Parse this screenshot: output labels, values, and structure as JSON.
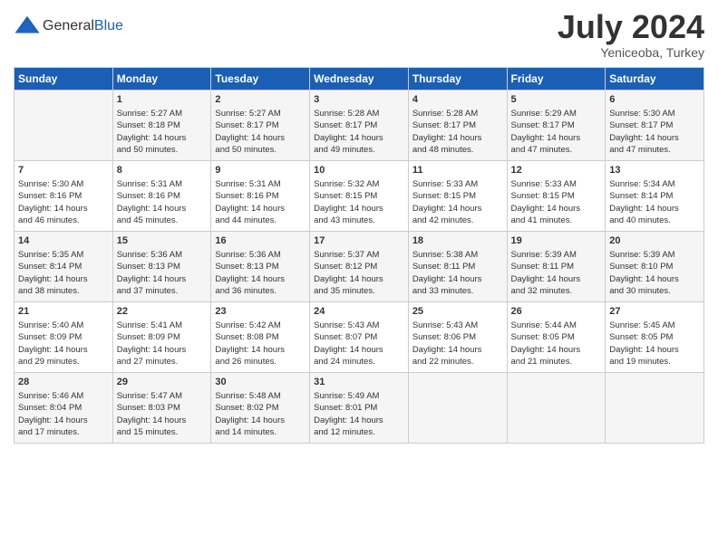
{
  "header": {
    "logo": {
      "general": "General",
      "blue": "Blue"
    },
    "title": "July 2024",
    "subtitle": "Yeniceoba, Turkey"
  },
  "weekdays": [
    "Sunday",
    "Monday",
    "Tuesday",
    "Wednesday",
    "Thursday",
    "Friday",
    "Saturday"
  ],
  "weeks": [
    [
      {
        "day": "",
        "info": ""
      },
      {
        "day": "1",
        "info": "Sunrise: 5:27 AM\nSunset: 8:18 PM\nDaylight: 14 hours\nand 50 minutes."
      },
      {
        "day": "2",
        "info": "Sunrise: 5:27 AM\nSunset: 8:17 PM\nDaylight: 14 hours\nand 50 minutes."
      },
      {
        "day": "3",
        "info": "Sunrise: 5:28 AM\nSunset: 8:17 PM\nDaylight: 14 hours\nand 49 minutes."
      },
      {
        "day": "4",
        "info": "Sunrise: 5:28 AM\nSunset: 8:17 PM\nDaylight: 14 hours\nand 48 minutes."
      },
      {
        "day": "5",
        "info": "Sunrise: 5:29 AM\nSunset: 8:17 PM\nDaylight: 14 hours\nand 47 minutes."
      },
      {
        "day": "6",
        "info": "Sunrise: 5:30 AM\nSunset: 8:17 PM\nDaylight: 14 hours\nand 47 minutes."
      }
    ],
    [
      {
        "day": "7",
        "info": "Sunrise: 5:30 AM\nSunset: 8:16 PM\nDaylight: 14 hours\nand 46 minutes."
      },
      {
        "day": "8",
        "info": "Sunrise: 5:31 AM\nSunset: 8:16 PM\nDaylight: 14 hours\nand 45 minutes."
      },
      {
        "day": "9",
        "info": "Sunrise: 5:31 AM\nSunset: 8:16 PM\nDaylight: 14 hours\nand 44 minutes."
      },
      {
        "day": "10",
        "info": "Sunrise: 5:32 AM\nSunset: 8:15 PM\nDaylight: 14 hours\nand 43 minutes."
      },
      {
        "day": "11",
        "info": "Sunrise: 5:33 AM\nSunset: 8:15 PM\nDaylight: 14 hours\nand 42 minutes."
      },
      {
        "day": "12",
        "info": "Sunrise: 5:33 AM\nSunset: 8:15 PM\nDaylight: 14 hours\nand 41 minutes."
      },
      {
        "day": "13",
        "info": "Sunrise: 5:34 AM\nSunset: 8:14 PM\nDaylight: 14 hours\nand 40 minutes."
      }
    ],
    [
      {
        "day": "14",
        "info": "Sunrise: 5:35 AM\nSunset: 8:14 PM\nDaylight: 14 hours\nand 38 minutes."
      },
      {
        "day": "15",
        "info": "Sunrise: 5:36 AM\nSunset: 8:13 PM\nDaylight: 14 hours\nand 37 minutes."
      },
      {
        "day": "16",
        "info": "Sunrise: 5:36 AM\nSunset: 8:13 PM\nDaylight: 14 hours\nand 36 minutes."
      },
      {
        "day": "17",
        "info": "Sunrise: 5:37 AM\nSunset: 8:12 PM\nDaylight: 14 hours\nand 35 minutes."
      },
      {
        "day": "18",
        "info": "Sunrise: 5:38 AM\nSunset: 8:11 PM\nDaylight: 14 hours\nand 33 minutes."
      },
      {
        "day": "19",
        "info": "Sunrise: 5:39 AM\nSunset: 8:11 PM\nDaylight: 14 hours\nand 32 minutes."
      },
      {
        "day": "20",
        "info": "Sunrise: 5:39 AM\nSunset: 8:10 PM\nDaylight: 14 hours\nand 30 minutes."
      }
    ],
    [
      {
        "day": "21",
        "info": "Sunrise: 5:40 AM\nSunset: 8:09 PM\nDaylight: 14 hours\nand 29 minutes."
      },
      {
        "day": "22",
        "info": "Sunrise: 5:41 AM\nSunset: 8:09 PM\nDaylight: 14 hours\nand 27 minutes."
      },
      {
        "day": "23",
        "info": "Sunrise: 5:42 AM\nSunset: 8:08 PM\nDaylight: 14 hours\nand 26 minutes."
      },
      {
        "day": "24",
        "info": "Sunrise: 5:43 AM\nSunset: 8:07 PM\nDaylight: 14 hours\nand 24 minutes."
      },
      {
        "day": "25",
        "info": "Sunrise: 5:43 AM\nSunset: 8:06 PM\nDaylight: 14 hours\nand 22 minutes."
      },
      {
        "day": "26",
        "info": "Sunrise: 5:44 AM\nSunset: 8:05 PM\nDaylight: 14 hours\nand 21 minutes."
      },
      {
        "day": "27",
        "info": "Sunrise: 5:45 AM\nSunset: 8:05 PM\nDaylight: 14 hours\nand 19 minutes."
      }
    ],
    [
      {
        "day": "28",
        "info": "Sunrise: 5:46 AM\nSunset: 8:04 PM\nDaylight: 14 hours\nand 17 minutes."
      },
      {
        "day": "29",
        "info": "Sunrise: 5:47 AM\nSunset: 8:03 PM\nDaylight: 14 hours\nand 15 minutes."
      },
      {
        "day": "30",
        "info": "Sunrise: 5:48 AM\nSunset: 8:02 PM\nDaylight: 14 hours\nand 14 minutes."
      },
      {
        "day": "31",
        "info": "Sunrise: 5:49 AM\nSunset: 8:01 PM\nDaylight: 14 hours\nand 12 minutes."
      },
      {
        "day": "",
        "info": ""
      },
      {
        "day": "",
        "info": ""
      },
      {
        "day": "",
        "info": ""
      }
    ]
  ]
}
